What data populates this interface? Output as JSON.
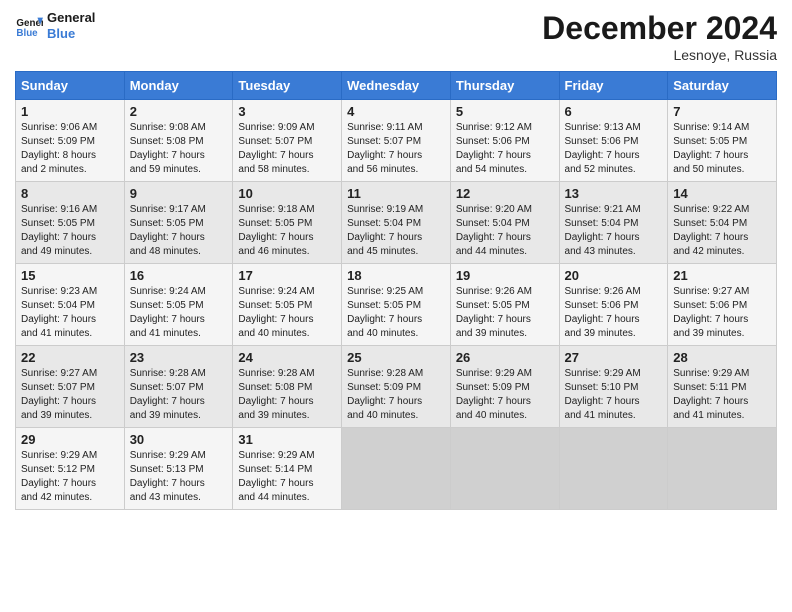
{
  "logo": {
    "line1": "General",
    "line2": "Blue"
  },
  "title": "December 2024",
  "subtitle": "Lesnoye, Russia",
  "days_of_week": [
    "Sunday",
    "Monday",
    "Tuesday",
    "Wednesday",
    "Thursday",
    "Friday",
    "Saturday"
  ],
  "weeks": [
    [
      {
        "day": "1",
        "info": "Sunrise: 9:06 AM\nSunset: 5:09 PM\nDaylight: 8 hours\nand 2 minutes."
      },
      {
        "day": "2",
        "info": "Sunrise: 9:08 AM\nSunset: 5:08 PM\nDaylight: 7 hours\nand 59 minutes."
      },
      {
        "day": "3",
        "info": "Sunrise: 9:09 AM\nSunset: 5:07 PM\nDaylight: 7 hours\nand 58 minutes."
      },
      {
        "day": "4",
        "info": "Sunrise: 9:11 AM\nSunset: 5:07 PM\nDaylight: 7 hours\nand 56 minutes."
      },
      {
        "day": "5",
        "info": "Sunrise: 9:12 AM\nSunset: 5:06 PM\nDaylight: 7 hours\nand 54 minutes."
      },
      {
        "day": "6",
        "info": "Sunrise: 9:13 AM\nSunset: 5:06 PM\nDaylight: 7 hours\nand 52 minutes."
      },
      {
        "day": "7",
        "info": "Sunrise: 9:14 AM\nSunset: 5:05 PM\nDaylight: 7 hours\nand 50 minutes."
      }
    ],
    [
      {
        "day": "8",
        "info": "Sunrise: 9:16 AM\nSunset: 5:05 PM\nDaylight: 7 hours\nand 49 minutes."
      },
      {
        "day": "9",
        "info": "Sunrise: 9:17 AM\nSunset: 5:05 PM\nDaylight: 7 hours\nand 48 minutes."
      },
      {
        "day": "10",
        "info": "Sunrise: 9:18 AM\nSunset: 5:05 PM\nDaylight: 7 hours\nand 46 minutes."
      },
      {
        "day": "11",
        "info": "Sunrise: 9:19 AM\nSunset: 5:04 PM\nDaylight: 7 hours\nand 45 minutes."
      },
      {
        "day": "12",
        "info": "Sunrise: 9:20 AM\nSunset: 5:04 PM\nDaylight: 7 hours\nand 44 minutes."
      },
      {
        "day": "13",
        "info": "Sunrise: 9:21 AM\nSunset: 5:04 PM\nDaylight: 7 hours\nand 43 minutes."
      },
      {
        "day": "14",
        "info": "Sunrise: 9:22 AM\nSunset: 5:04 PM\nDaylight: 7 hours\nand 42 minutes."
      }
    ],
    [
      {
        "day": "15",
        "info": "Sunrise: 9:23 AM\nSunset: 5:04 PM\nDaylight: 7 hours\nand 41 minutes."
      },
      {
        "day": "16",
        "info": "Sunrise: 9:24 AM\nSunset: 5:05 PM\nDaylight: 7 hours\nand 41 minutes."
      },
      {
        "day": "17",
        "info": "Sunrise: 9:24 AM\nSunset: 5:05 PM\nDaylight: 7 hours\nand 40 minutes."
      },
      {
        "day": "18",
        "info": "Sunrise: 9:25 AM\nSunset: 5:05 PM\nDaylight: 7 hours\nand 40 minutes."
      },
      {
        "day": "19",
        "info": "Sunrise: 9:26 AM\nSunset: 5:05 PM\nDaylight: 7 hours\nand 39 minutes."
      },
      {
        "day": "20",
        "info": "Sunrise: 9:26 AM\nSunset: 5:06 PM\nDaylight: 7 hours\nand 39 minutes."
      },
      {
        "day": "21",
        "info": "Sunrise: 9:27 AM\nSunset: 5:06 PM\nDaylight: 7 hours\nand 39 minutes."
      }
    ],
    [
      {
        "day": "22",
        "info": "Sunrise: 9:27 AM\nSunset: 5:07 PM\nDaylight: 7 hours\nand 39 minutes."
      },
      {
        "day": "23",
        "info": "Sunrise: 9:28 AM\nSunset: 5:07 PM\nDaylight: 7 hours\nand 39 minutes."
      },
      {
        "day": "24",
        "info": "Sunrise: 9:28 AM\nSunset: 5:08 PM\nDaylight: 7 hours\nand 39 minutes."
      },
      {
        "day": "25",
        "info": "Sunrise: 9:28 AM\nSunset: 5:09 PM\nDaylight: 7 hours\nand 40 minutes."
      },
      {
        "day": "26",
        "info": "Sunrise: 9:29 AM\nSunset: 5:09 PM\nDaylight: 7 hours\nand 40 minutes."
      },
      {
        "day": "27",
        "info": "Sunrise: 9:29 AM\nSunset: 5:10 PM\nDaylight: 7 hours\nand 41 minutes."
      },
      {
        "day": "28",
        "info": "Sunrise: 9:29 AM\nSunset: 5:11 PM\nDaylight: 7 hours\nand 41 minutes."
      }
    ],
    [
      {
        "day": "29",
        "info": "Sunrise: 9:29 AM\nSunset: 5:12 PM\nDaylight: 7 hours\nand 42 minutes."
      },
      {
        "day": "30",
        "info": "Sunrise: 9:29 AM\nSunset: 5:13 PM\nDaylight: 7 hours\nand 43 minutes."
      },
      {
        "day": "31",
        "info": "Sunrise: 9:29 AM\nSunset: 5:14 PM\nDaylight: 7 hours\nand 44 minutes."
      },
      null,
      null,
      null,
      null
    ]
  ]
}
